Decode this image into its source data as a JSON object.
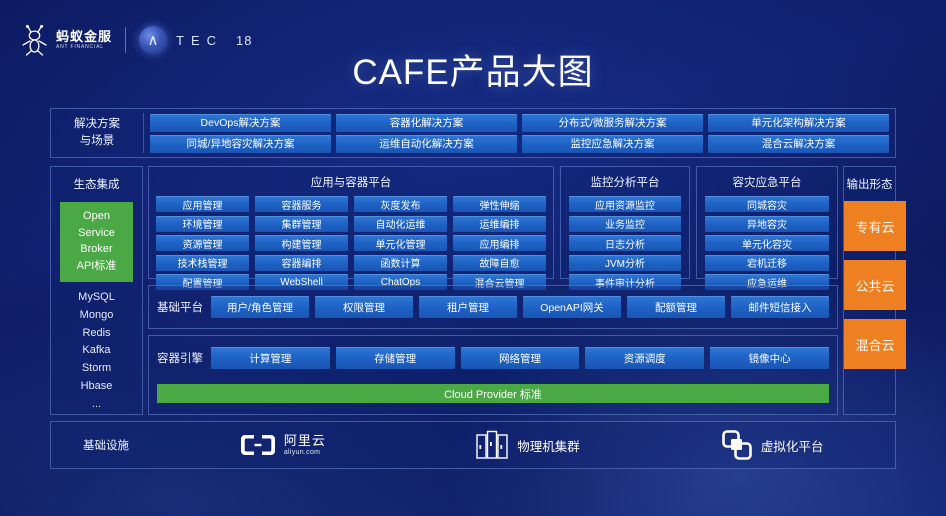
{
  "header": {
    "ant_logo_cn": "蚂蚁金服",
    "ant_logo_en": "ANT FINANCIAL",
    "atec_a": "∧",
    "atec_letters": "TEC",
    "atec_number": "18"
  },
  "title": "CAFE产品大图",
  "solutions": {
    "label_line1": "解决方案",
    "label_line2": "与场景",
    "row1": [
      "DevOps解决方案",
      "容器化解决方案",
      "分布式/微服务解决方案",
      "单元化架构解决方案"
    ],
    "row2": [
      "同城/异地容灾解决方案",
      "运维自动化解决方案",
      "监控应急解决方案",
      "混合云解决方案"
    ]
  },
  "ecosystem": {
    "title": "生态集成",
    "osb": [
      "Open",
      "Service",
      "Broker",
      "API标准"
    ],
    "items": [
      "MySQL",
      "Mongo",
      "Redis",
      "Kafka",
      "Storm",
      "Hbase",
      "..."
    ]
  },
  "app_platform": {
    "title": "应用与容器平台",
    "col1": [
      "应用管理",
      "环境管理",
      "资源管理",
      "技术栈管理",
      "配置管理"
    ],
    "col2": [
      "容器服务",
      "集群管理",
      "构建管理",
      "容器编排",
      "WebShell"
    ],
    "col3": [
      "灰度发布",
      "自动化运维",
      "单元化管理",
      "函数计算",
      "ChatOps"
    ],
    "col4": [
      "弹性伸缩",
      "运维编排",
      "应用编排",
      "故障自愈",
      "混合云管理"
    ]
  },
  "monitor_platform": {
    "title": "监控分析平台",
    "items": [
      "应用资源监控",
      "业务监控",
      "日志分析",
      "JVM分析",
      "事件审计分析"
    ]
  },
  "dr_platform": {
    "title": "容灾应急平台",
    "items": [
      "同城容灾",
      "异地容灾",
      "单元化容灾",
      "宕机迁移",
      "应急运维"
    ]
  },
  "base_platform": {
    "label": "基础平台",
    "items": [
      "用户/角色管理",
      "权限管理",
      "租户管理",
      "OpenAPI网关",
      "配额管理",
      "邮件短信接入"
    ]
  },
  "container_engine": {
    "label": "容器引擎",
    "items": [
      "计算管理",
      "存储管理",
      "网络管理",
      "资源调度",
      "镜像中心"
    ],
    "cloud_provider": "Cloud Provider 标准"
  },
  "output_forms": {
    "title": "输出形态",
    "items": [
      "专有云",
      "公共云",
      "混合云"
    ]
  },
  "infrastructure": {
    "label": "基础设施",
    "items": [
      {
        "icon": "aliyun-logo-icon",
        "cn": "阿里云",
        "en": "aliyun.com"
      },
      {
        "icon": "server-rack-icon",
        "text": "物理机集群"
      },
      {
        "icon": "vmware-logo-icon",
        "text": "虚拟化平台"
      }
    ]
  },
  "colors": {
    "background_deep": "#0d1b63",
    "button_blue": "#2f78d6",
    "green": "#4aa845",
    "orange": "#ef8022",
    "panel_border": "#7896e1"
  }
}
